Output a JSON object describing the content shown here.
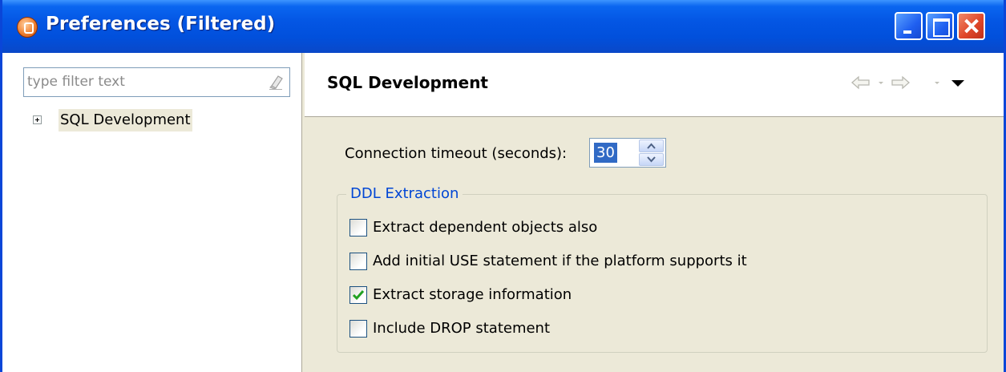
{
  "window": {
    "title": "Preferences (Filtered)",
    "controls": [
      "minimize",
      "maximize",
      "close"
    ],
    "icon": "preferences-app-icon"
  },
  "left": {
    "filter_placeholder": "type filter text",
    "filter_value": "",
    "clear_icon": "eraser-icon",
    "tree": [
      {
        "label": "SQL Development",
        "expanded": false,
        "selected": true
      }
    ]
  },
  "page": {
    "title": "SQL Development",
    "nav": {
      "back": "back-arrow-icon",
      "forward": "forward-arrow-icon",
      "menu": "view-menu-icon"
    },
    "timeout_label": "Connection timeout (seconds):",
    "timeout_value": "30",
    "group": {
      "label": "DDL Extraction",
      "options": [
        {
          "label": "Extract dependent objects also",
          "checked": false
        },
        {
          "label": "Add initial USE statement if the platform supports it",
          "checked": false
        },
        {
          "label": "Extract storage information",
          "checked": true
        },
        {
          "label": "Include DROP statement",
          "checked": false
        }
      ]
    }
  },
  "colors": {
    "titlebar": "#0456e4",
    "group_label": "#0046d5",
    "selection": "#316ac5",
    "checkmark": "#21a121"
  }
}
